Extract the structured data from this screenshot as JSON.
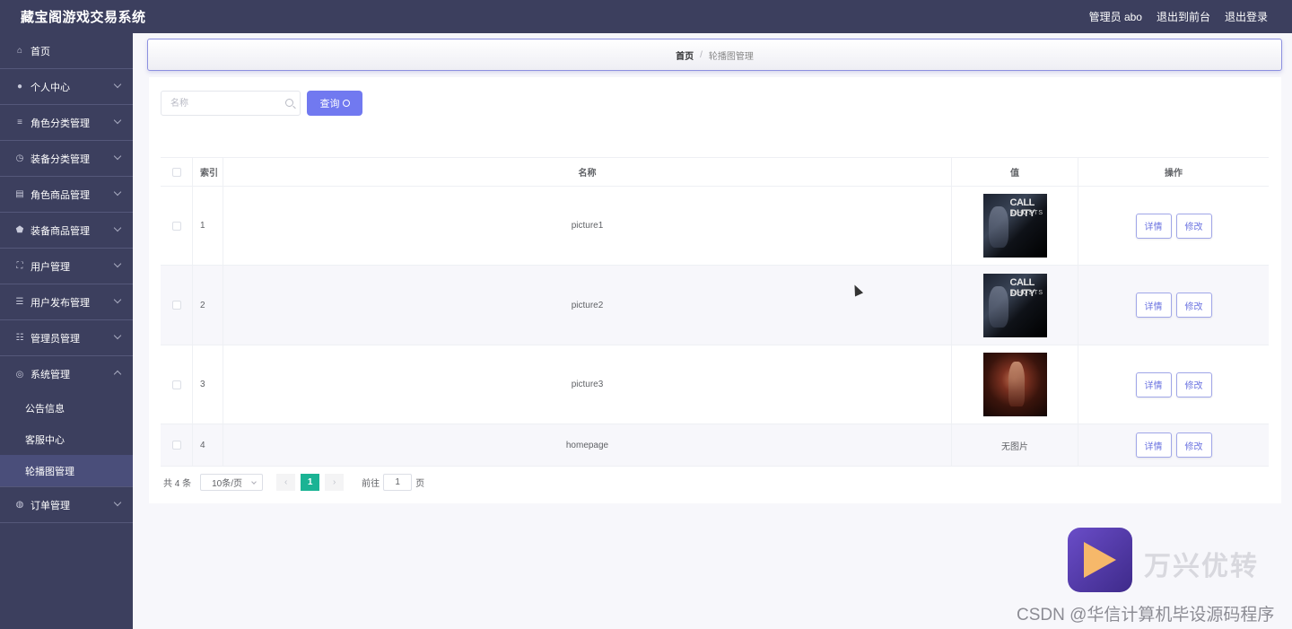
{
  "app": {
    "title": "藏宝阁游戏交易系统"
  },
  "topbar": {
    "user": "管理员 abo",
    "to_front": "退出到前台",
    "logout": "退出登录"
  },
  "sidebar": {
    "items": [
      {
        "label": "首页",
        "icon": "home-icon"
      },
      {
        "label": "个人中心",
        "icon": "user-icon"
      },
      {
        "label": "角色分类管理",
        "icon": "list-icon"
      },
      {
        "label": "装备分类管理",
        "icon": "clock-icon"
      },
      {
        "label": "角色商品管理",
        "icon": "doc-icon"
      },
      {
        "label": "装备商品管理",
        "icon": "shield-icon"
      },
      {
        "label": "用户管理",
        "icon": "frame-icon"
      },
      {
        "label": "用户发布管理",
        "icon": "list-icon"
      },
      {
        "label": "管理员管理",
        "icon": "sliders-icon"
      },
      {
        "label": "系统管理",
        "icon": "compass-icon"
      },
      {
        "label": "订单管理",
        "icon": "globe-icon"
      }
    ],
    "sub": [
      "公告信息",
      "客服中心",
      "轮播图管理"
    ]
  },
  "breadcrumb": {
    "home": "首页",
    "sep": "/",
    "current": "轮播图管理"
  },
  "search": {
    "placeholder": "名称",
    "button": "查询"
  },
  "table": {
    "headers": [
      "索引",
      "名称",
      "值",
      "操作"
    ],
    "rows": [
      {
        "index": "1",
        "name": "picture1",
        "value_image": "call-of-duty-ghosts"
      },
      {
        "index": "2",
        "name": "picture2",
        "value_image": "call-of-duty-ghosts"
      },
      {
        "index": "3",
        "name": "picture3",
        "value_image": "fire-character"
      },
      {
        "index": "4",
        "name": "homepage",
        "value_text": "无图片"
      }
    ],
    "detail_label": "详情",
    "edit_label": "修改"
  },
  "thumb": {
    "cod_title": "CALL DUTY",
    "cod_sub": "GHOSTS"
  },
  "pager": {
    "total": "共 4 条",
    "page_size": "10条/页",
    "prev": "‹",
    "next": "›",
    "current_page": "1",
    "goto_prefix": "前往",
    "goto_value": "1",
    "goto_suffix": "页"
  },
  "watermark": {
    "brand": "万兴优转",
    "csdn": "CSDN @华信计算机毕设源码程序"
  },
  "colors": {
    "sidebar": "#3c3f5e",
    "accent": "#7179f0",
    "page_active": "#1ab394"
  }
}
